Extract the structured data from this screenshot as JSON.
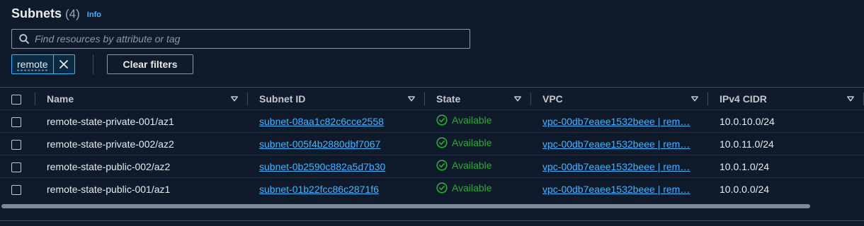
{
  "header": {
    "title": "Subnets",
    "count": "(4)",
    "info_label": "Info"
  },
  "search": {
    "placeholder": "Find resources by attribute or tag",
    "value": ""
  },
  "filter_token": {
    "label": "remote"
  },
  "clear_filters_label": "Clear filters",
  "table": {
    "columns": [
      "Name",
      "Subnet ID",
      "State",
      "VPC",
      "IPv4 CIDR"
    ],
    "rows": [
      {
        "name": "remote-state-private-001/az1",
        "subnet_id": "subnet-08aa1c82c6cce2558",
        "state": "Available",
        "vpc": "vpc-00db7eaee1532beee | rem…",
        "cidr": "10.0.10.0/24"
      },
      {
        "name": "remote-state-private-002/az2",
        "subnet_id": "subnet-005f4b2880dbf7067",
        "state": "Available",
        "vpc": "vpc-00db7eaee1532beee | rem…",
        "cidr": "10.0.11.0/24"
      },
      {
        "name": "remote-state-public-002/az2",
        "subnet_id": "subnet-0b2590c882a5d7b30",
        "state": "Available",
        "vpc": "vpc-00db7eaee1532beee | rem…",
        "cidr": "10.0.1.0/24"
      },
      {
        "name": "remote-state-public-001/az1",
        "subnet_id": "subnet-01b22fcc86c2871f6",
        "state": "Available",
        "vpc": "vpc-00db7eaee1532beee | rem…",
        "cidr": "10.0.0.0/24"
      }
    ]
  },
  "icons": {
    "search": "search-icon",
    "dismiss": "close-icon",
    "sort": "caret-down-icon",
    "state": "check-circle-icon"
  },
  "colors": {
    "link": "#42b4ff",
    "available": "#29ad32",
    "background": "#0f1b2a"
  }
}
